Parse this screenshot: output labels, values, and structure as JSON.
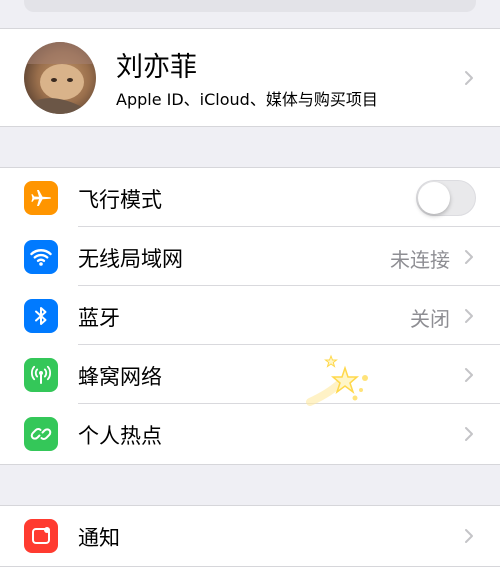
{
  "profile": {
    "name": "刘亦菲",
    "subtitle": "Apple ID、iCloud、媒体与购买项目"
  },
  "settings": [
    {
      "key": "airplane",
      "label": "飞行模式",
      "value": "",
      "icon": "airplane-icon",
      "color": "#ff9500",
      "control": "toggle",
      "toggle_on": false
    },
    {
      "key": "wifi",
      "label": "无线局域网",
      "value": "未连接",
      "icon": "wifi-icon",
      "color": "#007aff",
      "control": "chevron"
    },
    {
      "key": "bluetooth",
      "label": "蓝牙",
      "value": "关闭",
      "icon": "bluetooth-icon",
      "color": "#007aff",
      "control": "chevron"
    },
    {
      "key": "cellular",
      "label": "蜂窝网络",
      "value": "",
      "icon": "cellular-antenna-icon",
      "color": "#34c759",
      "control": "chevron"
    },
    {
      "key": "hotspot",
      "label": "个人热点",
      "value": "",
      "icon": "hotspot-link-icon",
      "color": "#34c759",
      "control": "chevron"
    }
  ],
  "next_section": {
    "label": "通知",
    "icon": "notifications-icon",
    "color": "#ff3b30"
  }
}
